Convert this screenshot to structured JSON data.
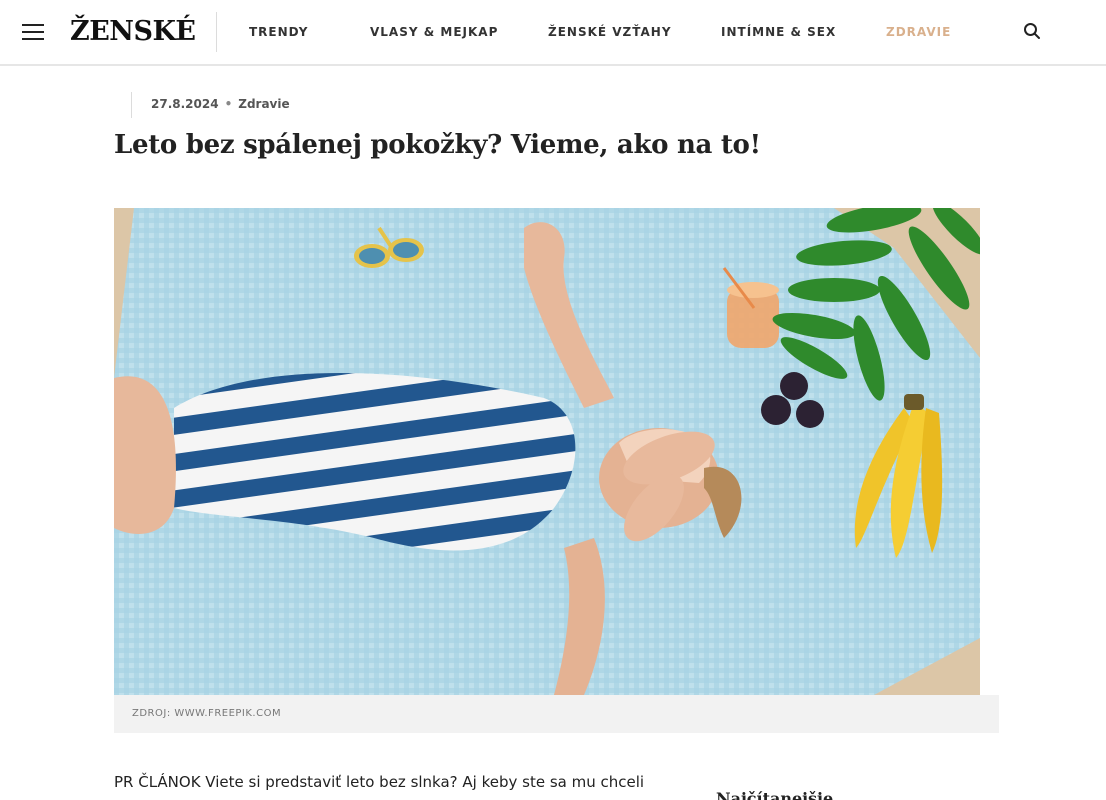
{
  "header": {
    "logo": "ŽENSKÉ",
    "nav": [
      {
        "label": "TRENDY",
        "active": false
      },
      {
        "label": "VLASY & MEJKAP",
        "active": false
      },
      {
        "label": "ŽENSKÉ VZŤAHY",
        "active": false
      },
      {
        "label": "INTÍMNE & SEX",
        "active": false
      },
      {
        "label": "ZDRAVIE",
        "active": true
      }
    ],
    "icons": {
      "menu": "hamburger-menu-icon",
      "search": "search-icon"
    }
  },
  "article": {
    "date": "27.8.2024",
    "category": "Zdravie",
    "title": "Leto bez spálenej pokožky? Vieme, ako na to!",
    "image_caption": "ZDROJ: WWW.FREEPIK.COM",
    "intro": "PR ČLÁNOK Viete si predstaviť leto bez slnka? Aj keby ste sa mu chceli"
  },
  "sidebar": {
    "heading": "Najčítanejšie"
  },
  "colors": {
    "accent": "#d9b08c",
    "caption_bg": "#f2f2f2"
  }
}
